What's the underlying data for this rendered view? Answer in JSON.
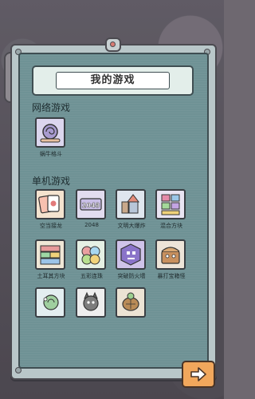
{
  "title": "我的游戏",
  "sections": {
    "online": {
      "label": "网络游戏",
      "games": [
        {
          "name": "蜗牛格斗",
          "icon": "snail-fight-icon"
        }
      ]
    },
    "single": {
      "label": "单机游戏",
      "games": [
        {
          "name": "空当接龙",
          "icon": "card-solitaire-icon"
        },
        {
          "name": "2048",
          "icon": "tiles-2048-icon"
        },
        {
          "name": "文明大爆炸",
          "icon": "city-icon"
        },
        {
          "name": "混合方块",
          "icon": "blocks-icon"
        },
        {
          "name": "土耳其方块",
          "icon": "brick-puzzle-icon"
        },
        {
          "name": "五彩连珠",
          "icon": "color-balls-icon"
        },
        {
          "name": "突破防火墙",
          "icon": "firewall-icon"
        },
        {
          "name": "暴打宝箱怪",
          "icon": "mimic-chest-icon"
        },
        {
          "name": "",
          "icon": "chameleon-icon"
        },
        {
          "name": "",
          "icon": "cat-icon"
        },
        {
          "name": "",
          "icon": "turtle-icon"
        }
      ]
    }
  },
  "next_button": {
    "icon": "arrow-right-icon"
  },
  "colors": {
    "screen": "#6f9295",
    "frame": "#b9c7c9",
    "button": "#f1a75c"
  }
}
